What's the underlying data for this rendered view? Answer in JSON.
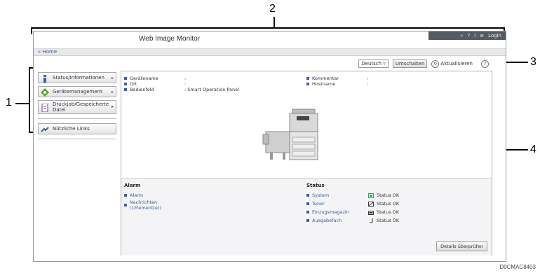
{
  "callouts": {
    "one": "1",
    "two": "2",
    "three": "3",
    "four": "4"
  },
  "window": {
    "title": "Web Image Monitor",
    "home": "Home"
  },
  "topbar": {
    "search": "⌕",
    "help": "?",
    "info": "i",
    "list": "≡",
    "login": "Login"
  },
  "toolbar": {
    "language": "Deutsch",
    "switch_label": "Umschalten",
    "refresh_label": "Aktualisieren",
    "help_label": "?"
  },
  "sidebar": {
    "items": [
      {
        "label": "Status/Informationen",
        "icon": "info-icon"
      },
      {
        "label": "Gerätemanagement",
        "icon": "diamond-gear-icon"
      },
      {
        "label": "Druckjob/Gespeicherte Datei",
        "icon": "document-icon"
      },
      {
        "label": "Nützliche Links",
        "icon": "link-arrow-icon"
      }
    ]
  },
  "device": {
    "left": [
      {
        "label": "Gerätename",
        "value": ":"
      },
      {
        "label": "Ort",
        "value": ":"
      },
      {
        "label": "Bedienfeld",
        "value": ": Smart Operation Panel"
      }
    ],
    "right": [
      {
        "label": "Kommentar",
        "value": ":"
      },
      {
        "label": "Hostname",
        "value": ":"
      }
    ]
  },
  "alarm": {
    "title": "Alarm",
    "items": [
      "Alarm",
      "Nachrichten (1Element(e))"
    ]
  },
  "status": {
    "title": "Status",
    "rows": [
      {
        "label": "System",
        "value": "Status OK",
        "icon": "system-ok-icon",
        "color": "#2da84a"
      },
      {
        "label": "Toner",
        "value": "Status OK",
        "icon": "toner-icon",
        "color": "#333333"
      },
      {
        "label": "Einzugsmagazin",
        "value": "Status OK",
        "icon": "tray-icon",
        "color": "#333333"
      },
      {
        "label": "Ausgabefach",
        "value": "Status OK",
        "icon": "output-tray-icon",
        "color": "#333333"
      }
    ]
  },
  "details_button": "Details überprüfen",
  "footer_code": "D0CMAC8403"
}
